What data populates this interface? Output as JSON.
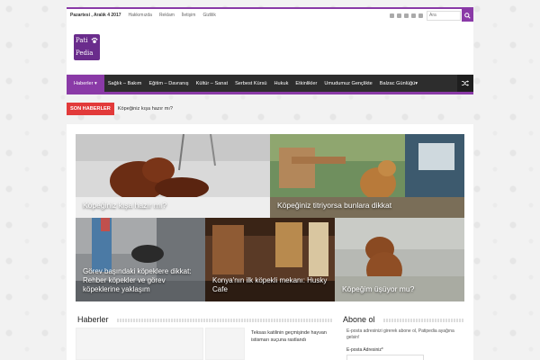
{
  "topbar": {
    "date": "Pazartesi , Aralık 4 2017",
    "links": [
      "Hakkımızda",
      "Reklam",
      "İletişim",
      "Gizlilik"
    ],
    "search_placeholder": "Ara",
    "accent": "#8a3aa7"
  },
  "logo": {
    "line1": "Pati",
    "line2": "Pedia"
  },
  "nav": {
    "items": [
      "Haberler",
      "Sağlık – Bakım",
      "Eğitim – Davranış",
      "Kültür – Sanat",
      "Serbest Kürsü",
      "Hukuk",
      "Etkinlikler",
      "Umudumuz Gençlikte",
      "Balzac Günlüğü"
    ]
  },
  "ticker": {
    "label": "SON HABERLER",
    "text": "Köpeğiniz kışa hazır mı?",
    "color": "#e23a3a"
  },
  "featured": [
    {
      "caption": "Köpeğiniz kışa hazır mı?"
    },
    {
      "caption": "Köpeğiniz titriyorsa bunlara dikkat"
    },
    {
      "caption": "Görev başındaki köpeklere dikkat: Rehber köpekler ve görev köpeklerine yaklaşım"
    },
    {
      "caption": "Konya'nın ilk köpekli mekanı: Husky Cafe"
    },
    {
      "caption": "Köpeğim üşüyor mu?"
    }
  ],
  "news": {
    "title": "Haberler",
    "item_text": "Teksas katilinin geçmişinde hayvan istismarı suçuna rastlandı"
  },
  "subscribe": {
    "title": "Abone ol",
    "description": "E-posta adresinizi girerek abone ol, Patipedia ayağına gelsin!",
    "email_label": "E-posta Adresiniz*"
  }
}
